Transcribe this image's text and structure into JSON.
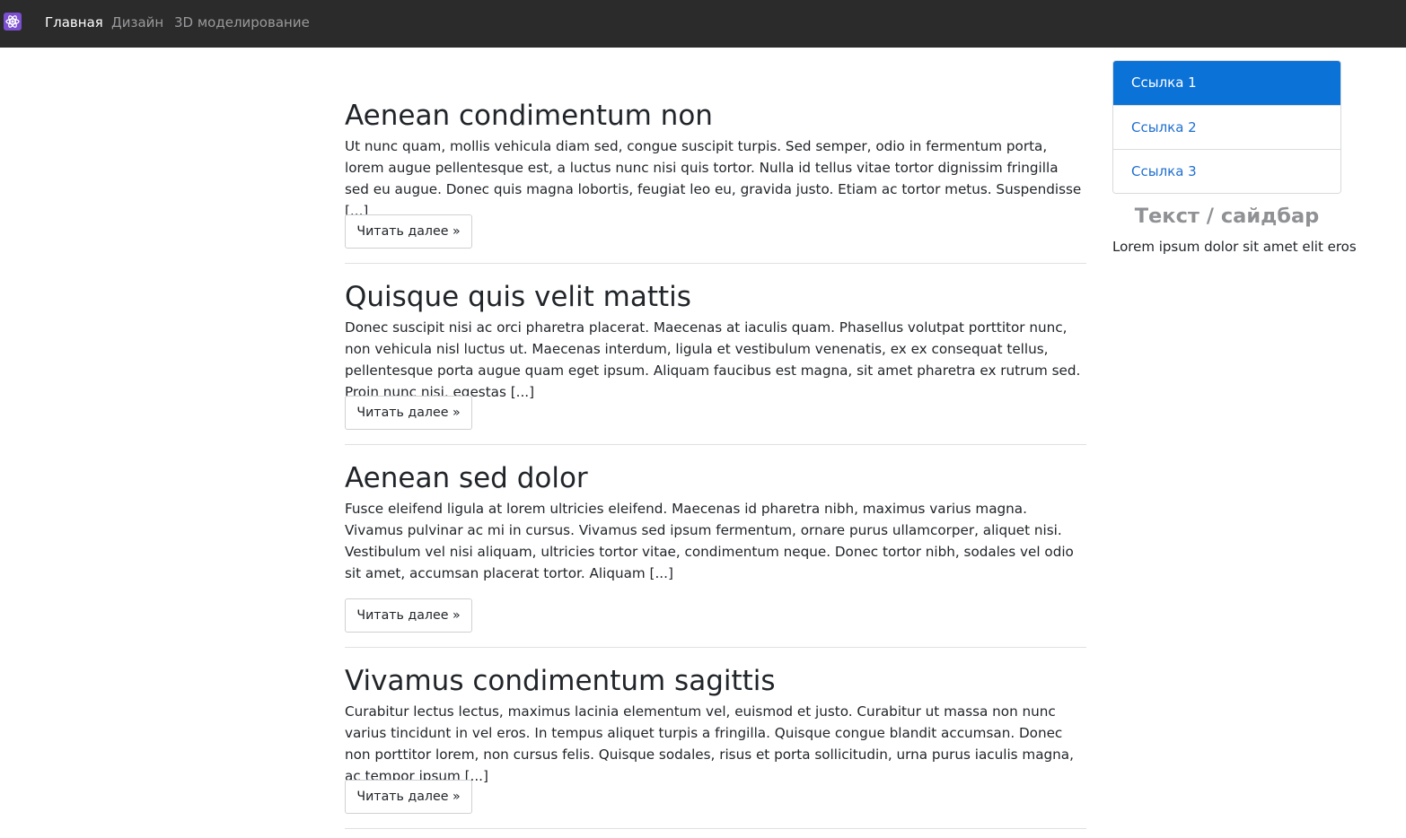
{
  "navbar": {
    "brand_icon": "atom-icon",
    "brand_color": "#7b4fd0",
    "items": [
      {
        "label": "Главная",
        "active": true
      },
      {
        "label": "Дизайн",
        "active": false
      },
      {
        "label": "3D моделирование",
        "active": false
      }
    ]
  },
  "posts": [
    {
      "title": "Aenean condimentum non",
      "text": "Ut nunc quam, mollis vehicula diam sed, congue suscipit turpis. Sed semper, odio in fermentum porta, lorem augue pellentesque est, a luctus nunc nisi quis tortor. Nulla id tellus vitae tortor dignissim fringilla sed eu augue. Donec quis magna lobortis, feugiat leo eu, gravida justo. Etiam ac tortor metus. Suspendisse [...]",
      "button": "Читать далее »"
    },
    {
      "title": "Quisque quis velit mattis",
      "text": "Donec suscipit nisi ac orci pharetra placerat. Maecenas at iaculis quam. Phasellus volutpat porttitor nunc, non vehicula nisl luctus ut. Maecenas interdum, ligula et vestibulum venenatis, ex ex consequat tellus, pellentesque porta augue quam eget ipsum. Aliquam faucibus est magna, sit amet pharetra ex rutrum sed. Proin nunc nisi, egestas [...]",
      "button": "Читать далее »"
    },
    {
      "title": "Aenean sed dolor",
      "text": "Fusce eleifend ligula at lorem ultricies eleifend. Maecenas id pharetra nibh, maximus varius magna. Vivamus pulvinar ac mi in cursus. Vivamus sed ipsum fermentum, ornare purus ullamcorper, aliquet nisi. Vestibulum vel nisi aliquam, ultricies tortor vitae, condimentum neque. Donec tortor nibh, sodales vel odio sit amet, accumsan placerat tortor. Aliquam [...]",
      "button": "Читать далее »"
    },
    {
      "title": "Vivamus condimentum sagittis",
      "text": "Curabitur lectus lectus, maximus lacinia elementum vel, euismod et justo. Curabitur ut massa non nunc varius tincidunt in vel eros. In tempus aliquet turpis a fringilla. Quisque congue blandit accumsan. Donec non porttitor lorem, non cursus felis. Quisque sodales, risus et porta sollicitudin, urna purus iaculis magna, ac tempor ipsum [...]",
      "button": "Читать далее »"
    }
  ],
  "sidebar": {
    "links": [
      {
        "label": "Ссылка 1",
        "active": true
      },
      {
        "label": "Ссылка 2",
        "active": false
      },
      {
        "label": "Ссылка 3",
        "active": false
      }
    ],
    "title": "Текст / сайдбар",
    "text": "Lorem ipsum dolor sit amet elit eros"
  },
  "colors": {
    "navbar_bg": "#2b2b2c",
    "accent": "#0b72d8",
    "link": "#1e6fd0"
  }
}
